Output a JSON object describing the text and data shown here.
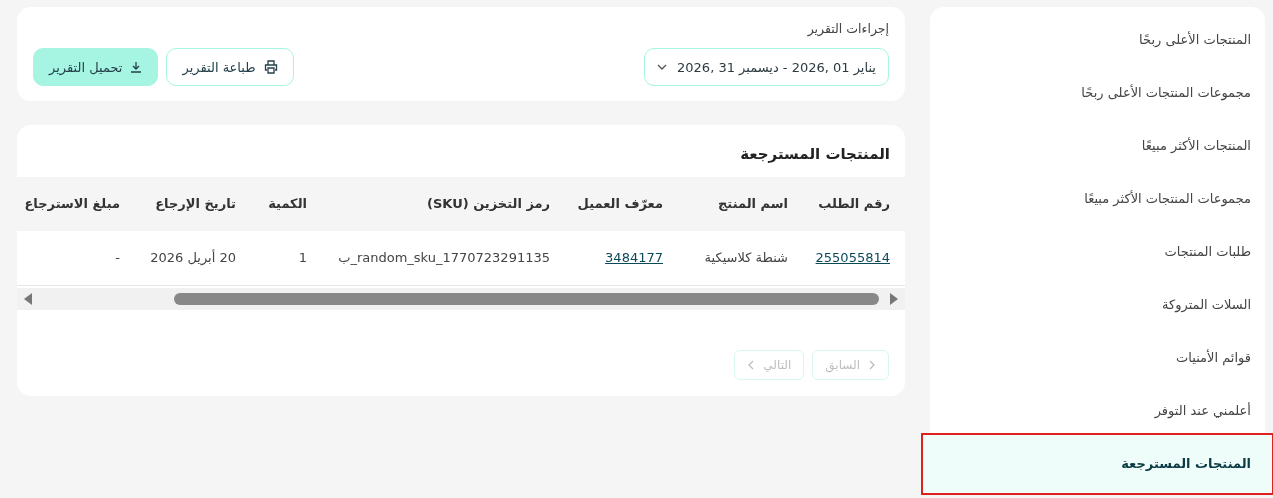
{
  "report_actions": {
    "title": "إجراءات التقرير",
    "date_range": "يناير 01 ,2026  -  ديسمبر 31 ,2026",
    "print_button": "طباعة التقرير",
    "download_button": "تحميل التقرير"
  },
  "table": {
    "title": "المنتجات المسترجعة",
    "columns": [
      "رقم الطلب",
      "اسم المنتج",
      "معرّف العميل",
      "رمز التخزين (SKU)",
      "الكمية",
      "تاريخ الإرجاع",
      "مبلغ الاسترجاع"
    ],
    "rows": [
      {
        "order_number": "255055814",
        "product_name": "شنطة كلاسيكية",
        "customer_id": "3484177",
        "sku": "random_sku_1770723291135_ب",
        "quantity": "1",
        "return_date": "20 أبريل 2026",
        "refund_amount": "-"
      }
    ]
  },
  "pagination": {
    "previous": {
      "label": "السابق",
      "disabled": true
    },
    "next": {
      "label": "التالي",
      "disabled": true
    }
  },
  "sidebar": {
    "items": [
      {
        "label": "المنتجات الأعلى ربحًا",
        "selected": false
      },
      {
        "label": "مجموعات المنتجات الأعلى ربحًا",
        "selected": false
      },
      {
        "label": "المنتجات الأكثر مبيعًا",
        "selected": false
      },
      {
        "label": "مجموعات المنتجات الأكثر مبيعًا",
        "selected": false
      },
      {
        "label": "طلبات المنتجات",
        "selected": false
      },
      {
        "label": "السلات المتروكة",
        "selected": false
      },
      {
        "label": "قوائم الأمنيات",
        "selected": false
      },
      {
        "label": "أعلمني عند التوفر",
        "selected": false
      },
      {
        "label": "المنتجات المسترجعة",
        "selected": true
      }
    ]
  }
}
